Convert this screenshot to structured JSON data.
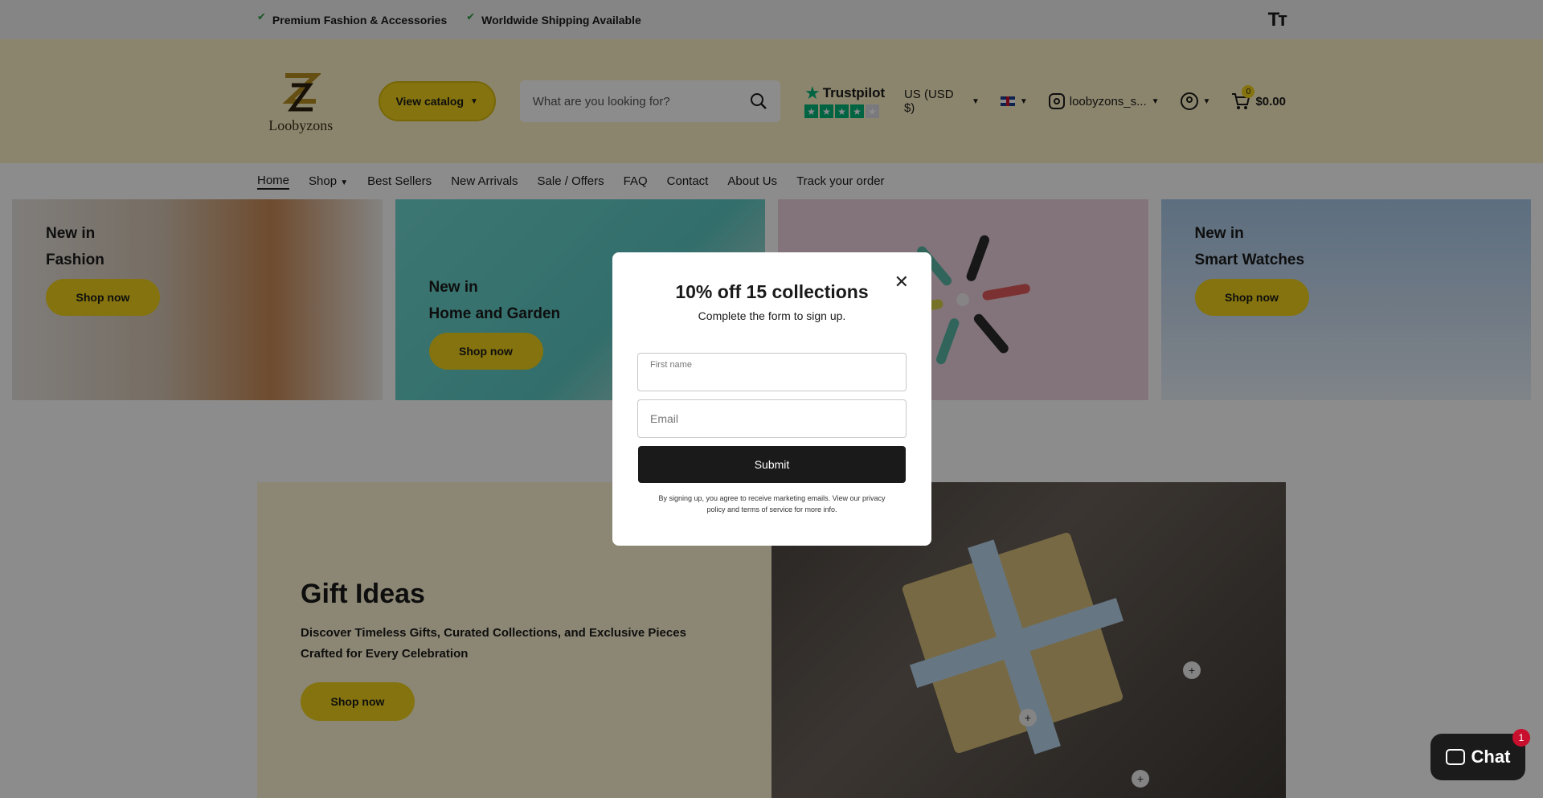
{
  "topbar": {
    "usp1": "Premium Fashion & Accessories",
    "usp2": "Worldwide Shipping Available",
    "text_size_icon": "Tт"
  },
  "header": {
    "logo_text": "Loobyzons",
    "catalog_label": "View catalog",
    "search_placeholder": "What are you looking for?",
    "trustpilot_label": "Trustpilot",
    "currency": "US (USD $)",
    "instagram_handle": "loobyzons_s...",
    "cart_count": "0",
    "cart_total": "$0.00"
  },
  "nav": {
    "items": [
      "Home",
      "Shop",
      "Best Sellers",
      "New Arrivals",
      "Sale / Offers",
      "FAQ",
      "Contact",
      "About Us",
      "Track your order"
    ]
  },
  "collections": [
    {
      "line1": "New in",
      "line2": "Fashion",
      "cta": "Shop now"
    },
    {
      "line1": "New in",
      "line2": "Home and Garden",
      "cta": "Shop now"
    },
    {
      "line1": "",
      "line2": "",
      "cta": ""
    },
    {
      "line1": "New in",
      "line2": "Smart Watches",
      "cta": "Shop now"
    }
  ],
  "gift": {
    "title": "Gift Ideas",
    "description": "Discover Timeless Gifts, Curated Collections, and Exclusive Pieces Crafted for Every Celebration",
    "cta": "Shop now"
  },
  "modal": {
    "title": "10% off 15 collections",
    "subtitle": "Complete the form to sign up.",
    "first_name_label": "First name",
    "email_placeholder": "Email",
    "submit_label": "Submit",
    "legal": "By signing up, you agree to receive marketing emails. View our privacy policy and terms of service for more info.",
    "close_icon": "close-icon"
  },
  "chat": {
    "label": "Chat",
    "badge": "1"
  },
  "colors": {
    "accent": "#f1d21b",
    "header_bg": "#fff3c6",
    "trustpilot_green": "#00b67a",
    "button_dark": "#1a1a1a"
  }
}
